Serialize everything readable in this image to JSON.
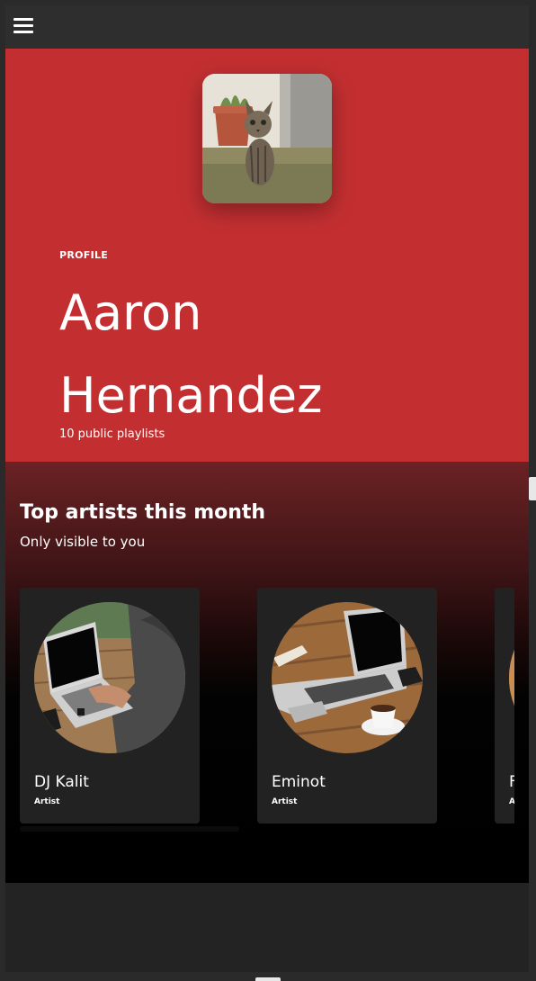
{
  "header": {
    "menu_icon": "hamburger-menu-icon"
  },
  "profile": {
    "label": "PROFILE",
    "name": "Aaron Hernandez",
    "subtitle": "10 public playlists",
    "hero_color": "#c32f31",
    "avatar": "cat-photo"
  },
  "top_artists": {
    "title": "Top artists this month",
    "subtitle": "Only visible to you",
    "artists": [
      {
        "name": "DJ Kalit",
        "type": "Artist",
        "image": "laptop-typing-photo"
      },
      {
        "name": "Eminot",
        "type": "Artist",
        "image": "laptop-coffee-photo"
      },
      {
        "name": "F",
        "type": "A",
        "image": "laptop-photo-partial"
      }
    ]
  }
}
